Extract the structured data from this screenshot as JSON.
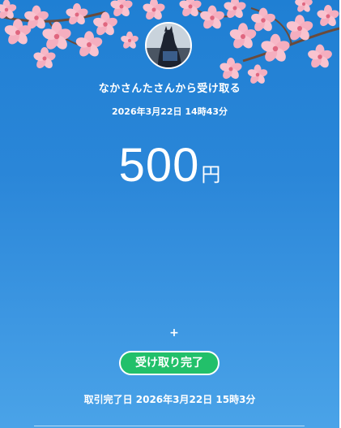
{
  "transfer": {
    "from_text": "なかさんたさんから受け取る",
    "datetime": "2026年3月22日 14時43分",
    "amount": "500",
    "currency_unit": "円",
    "plus_symbol": "+",
    "status_label": "受け取り完了",
    "completed_text": "取引完了日 2026年3月22日 15時3分"
  },
  "icons": {
    "avatar": "avatar-photo",
    "decoration": "cherry-blossom-branches"
  },
  "colors": {
    "background_top": "#1f7fd3",
    "background_bottom": "#4aa3e8",
    "status_green": "#22c06a",
    "blossom_pink": "#f7b7c6"
  }
}
